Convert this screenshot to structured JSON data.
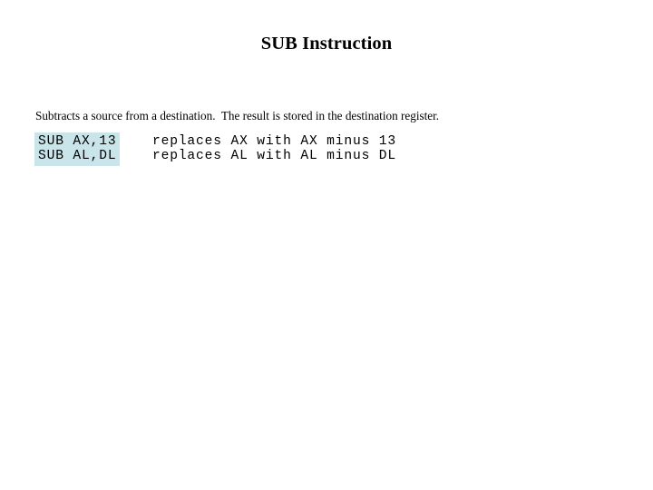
{
  "slide": {
    "title": "SUB Instruction",
    "description": "Subtracts a source from a destination.  The result is stored in the destination register.",
    "highlight_color": "#c9e5ea",
    "background_color": "#ffffff",
    "text_color": "#000000",
    "examples": [
      {
        "code": "SUB AX,13",
        "comment": "replaces AX with AX minus 13"
      },
      {
        "code": "SUB AL,DL",
        "comment": "replaces AL with AL minus DL"
      }
    ]
  }
}
